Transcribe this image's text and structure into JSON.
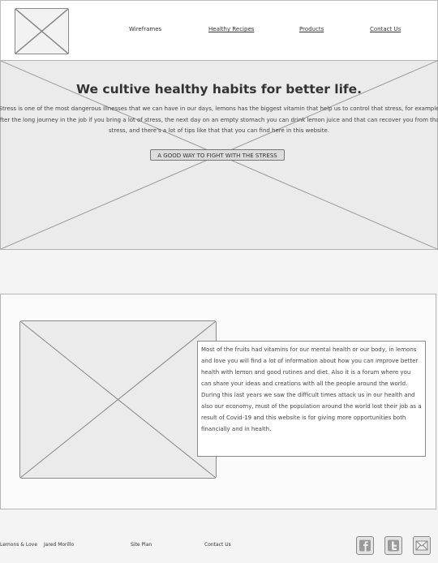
{
  "nav": {
    "items": [
      "Wireframes",
      "Healthy Recipes",
      "Products",
      "Contact Us"
    ],
    "logo_icon": "image-placeholder-icon"
  },
  "hero": {
    "title": "We cultive healthy habits for better life.",
    "text": "Stress is one of the most dangerous illnesses that we can have in our days, lemons has the biggest vitamin that help us to control that stress, for example after the long journey in the job if you bring a lot of stress, the next day on an empty stomach you can drink lemon juice and that can recover you from that stress, and there's a lot of tips like that that you can find here in this website.",
    "button_label": "A GOOD WAY TO FIGHT WITH THE STRESS"
  },
  "about": {
    "text": "Most of the fruits had vitamins for our mental health or our body, in lemons and love you will find a lot of information about how you can improve better health with lemon and good rutines and diet. Also it is a forum where you can share your ideas and creations with all the people around the world. During this last years we saw the difficult times attack us in our health and also our economy, must of the population around the world lost their job as a result of Covid-19 and this website is for giving more opportunities both financially and in health."
  },
  "footer": {
    "brand": "Lemons & Love",
    "author": "Jared Morillo",
    "site_plan": "Site Plan",
    "contact": "Contact Us",
    "social_icons": [
      "facebook-icon",
      "twitter-icon",
      "email-icon"
    ]
  }
}
